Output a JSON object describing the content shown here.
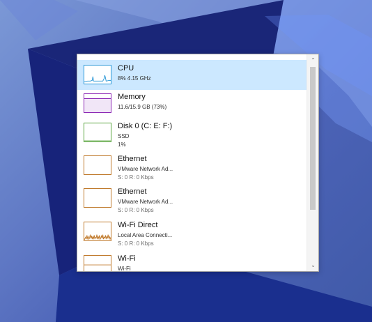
{
  "colors": {
    "selection": "#cce8ff",
    "cpu": "#2b98d6",
    "memory": "#8b26b4",
    "disk": "#58a43d",
    "network": "#c07a2c"
  },
  "scrollbar": {
    "up_icon": "chevron-up",
    "down_icon": "chevron-down",
    "up_glyph": "⌃",
    "down_glyph": "⌄"
  },
  "items": [
    {
      "title": "CPU",
      "line1": "8%  4.15 GHz",
      "line2": ""
    },
    {
      "title": "Memory",
      "line1": "11.6/15.9 GB (73%)",
      "line2": ""
    },
    {
      "title": "Disk 0 (C: E: F:)",
      "line1": "SSD",
      "line2": "1%"
    },
    {
      "title": "Ethernet",
      "line1": "VMware Network Ad...",
      "line2": "S: 0 R: 0 Kbps"
    },
    {
      "title": "Ethernet",
      "line1": "VMware Network Ad...",
      "line2": "S: 0 R: 0 Kbps"
    },
    {
      "title": "Wi-Fi Direct",
      "line1": "Local Area Connecti...",
      "line2": "S: 0 R: 0 Kbps"
    },
    {
      "title": "Wi-Fi",
      "line1": "Wi-Fi",
      "line2": ""
    }
  ]
}
